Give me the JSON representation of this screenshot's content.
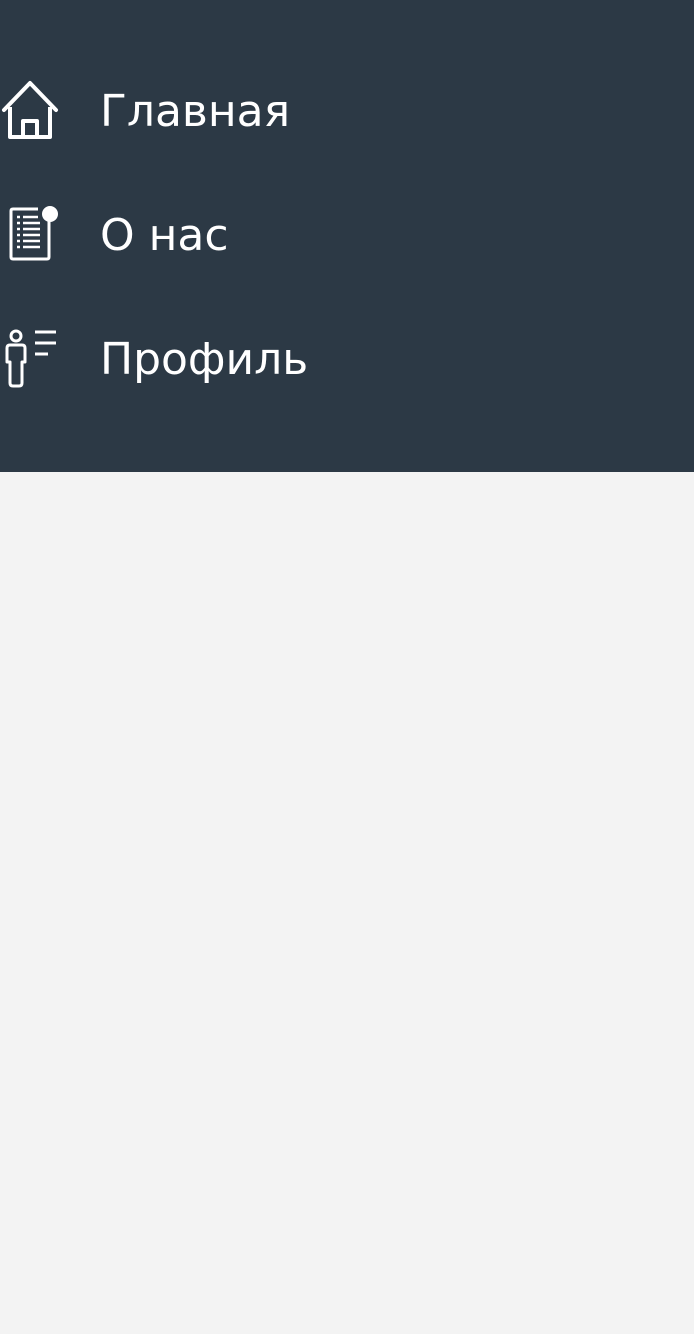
{
  "colors": {
    "menu_background": "#2c3945",
    "menu_text": "#ffffff",
    "content_background": "#f3f3f3"
  },
  "menu": {
    "items": [
      {
        "label": "Главная",
        "icon": "home-icon"
      },
      {
        "label": "О нас",
        "icon": "document-notification-icon"
      },
      {
        "label": "Профиль",
        "icon": "user-list-icon"
      }
    ]
  }
}
